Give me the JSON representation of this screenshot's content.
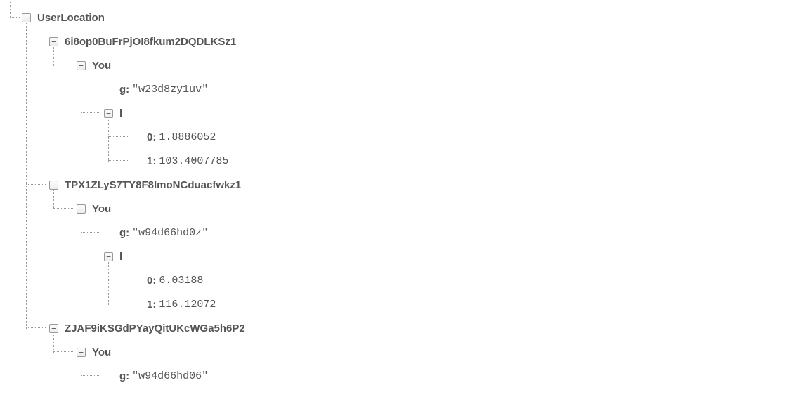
{
  "tree": {
    "root": {
      "label": "UserLocation",
      "expanded": true,
      "children": [
        {
          "label": "6i8op0BuFrPjOI8fkum2DQDLKSz1",
          "expanded": true,
          "children": [
            {
              "label": "You",
              "expanded": true,
              "children": [
                {
                  "key": "g",
                  "value": "\"w23d8zy1uv\"",
                  "leaf": true
                },
                {
                  "label": "l",
                  "expanded": true,
                  "children": [
                    {
                      "key": "0",
                      "value": "1.8886052",
                      "leaf": true
                    },
                    {
                      "key": "1",
                      "value": "103.4007785",
                      "leaf": true
                    }
                  ]
                }
              ]
            }
          ]
        },
        {
          "label": "TPX1ZLyS7TY8F8ImoNCduacfwkz1",
          "expanded": true,
          "children": [
            {
              "label": "You",
              "expanded": true,
              "children": [
                {
                  "key": "g",
                  "value": "\"w94d66hd0z\"",
                  "leaf": true
                },
                {
                  "label": "l",
                  "expanded": true,
                  "children": [
                    {
                      "key": "0",
                      "value": "6.03188",
                      "leaf": true
                    },
                    {
                      "key": "1",
                      "value": "116.12072",
                      "leaf": true
                    }
                  ]
                }
              ]
            }
          ]
        },
        {
          "label": "ZJAF9iKSGdPYayQitUKcWGa5h6P2",
          "expanded": true,
          "children": [
            {
              "label": "You",
              "expanded": true,
              "children": [
                {
                  "key": "g",
                  "value": "\"w94d66hd06\"",
                  "leaf": true
                }
              ]
            }
          ]
        }
      ]
    }
  },
  "icons": {
    "collapse_glyph": "−"
  }
}
